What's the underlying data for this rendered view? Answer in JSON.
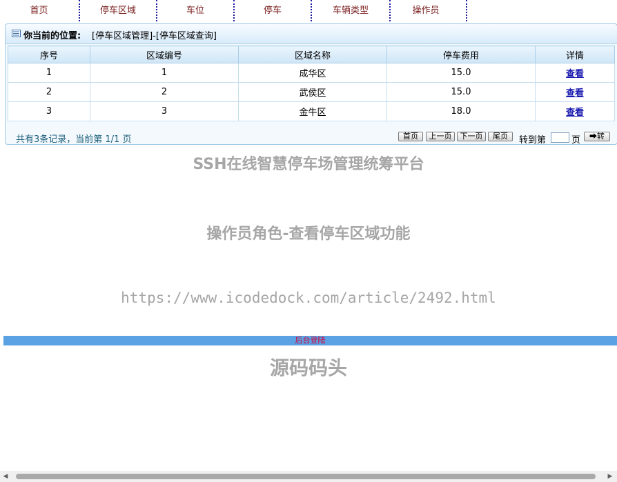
{
  "nav": {
    "items": [
      "首页",
      "停车区域",
      "车位",
      "停车",
      "车辆类型",
      "操作员"
    ]
  },
  "location": {
    "label": "你当前的位置:",
    "path": "[停车区域管理]-[停车区域查询]"
  },
  "table": {
    "headers": [
      "序号",
      "区域编号",
      "区域名称",
      "停车费用",
      "详情"
    ],
    "rows": [
      {
        "index": "1",
        "code": "1",
        "name": "成华区",
        "fee": "15.0",
        "link": "查看"
      },
      {
        "index": "2",
        "code": "2",
        "name": "武侯区",
        "fee": "15.0",
        "link": "查看"
      },
      {
        "index": "3",
        "code": "3",
        "name": "金牛区",
        "fee": "18.0",
        "link": "查看"
      }
    ]
  },
  "pager": {
    "summary": "共有3条记录，当前第 1/1 页",
    "first": "首页",
    "prev": "上一页",
    "next": "下一页",
    "last": "尾页",
    "goto_prefix": "转到第",
    "goto_suffix": "页",
    "go": "➡转"
  },
  "watermarks": {
    "title": "SSH在线智慧停车场管理统筹平台",
    "subtitle": "操作员角色-查看停车区域功能",
    "url": "https://www.icodedock.com/article/2492.html",
    "brand": "源码码头"
  },
  "footer_bar": {
    "link": "后台登陆"
  },
  "colors": {
    "nav_text": "#7a1d1d",
    "separator": "#1a1a9a",
    "panel_border": "#9fc9e7",
    "link": "#1a1ab0",
    "bar": "#5aa2e3",
    "bar_link": "#d8003a"
  }
}
